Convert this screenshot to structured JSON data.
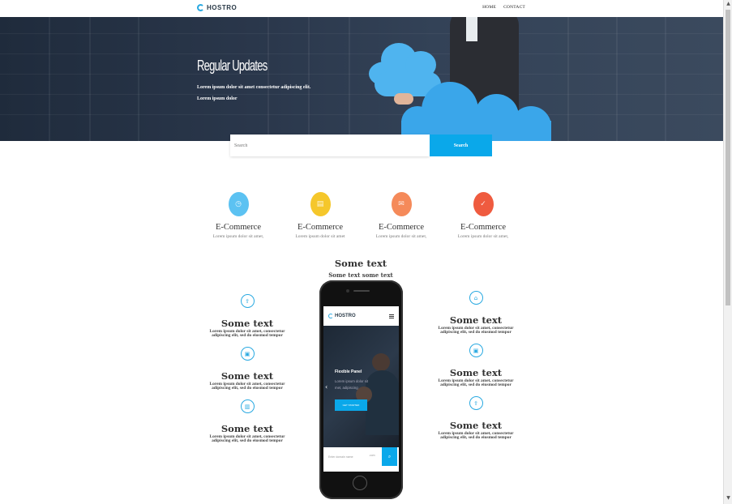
{
  "brand": {
    "name": "HOSTRO"
  },
  "nav": {
    "items": [
      {
        "label": "HOME"
      },
      {
        "label": "CONTACT"
      }
    ]
  },
  "hero": {
    "title": "Regular Updates",
    "line1": "Lorem ipsum dolor sit amet consectetur adipiscing elit.",
    "line2": "Lorem ipsum dolor"
  },
  "search": {
    "placeholder": "Search",
    "button_label": "Search"
  },
  "features": [
    {
      "title": "E-Commerce",
      "desc": "Lorem ipsum dolor sit amet,",
      "color": "#5cc2f2",
      "icon": "clock-icon"
    },
    {
      "title": "E-Commerce",
      "desc": "Lorem ipsum dolor sit amet",
      "color": "#f5c72b",
      "icon": "folder-icon"
    },
    {
      "title": "E-Commerce",
      "desc": "Lorem ipsum dolor sit amet,",
      "color": "#f58a5a",
      "icon": "mail-icon"
    },
    {
      "title": "E-Commerce",
      "desc": "Lorem ipsum dolor sit amet,",
      "color": "#ef5b3f",
      "icon": "check-icon"
    }
  ],
  "center": {
    "title": "Some text",
    "subtitle": "Some text some text"
  },
  "left_items": [
    {
      "title": "Some text",
      "desc": "Lorem ipsum dolor sit amet, consectetur adipiscing elit, sed do eiusmod tempor",
      "icon": "share-icon"
    },
    {
      "title": "Some text",
      "desc": "Lorem ipsum dolor sit amet, consectetur adipiscing elit, sed do eiusmod tempor",
      "icon": "image-icon"
    },
    {
      "title": "Some text",
      "desc": "Lorem ipsum dolor sit amet, consectetur adipiscing elit, sed do eiusmod tempor",
      "icon": "bar-chart-icon"
    }
  ],
  "right_items": [
    {
      "title": "Some text",
      "desc": "Lorem ipsum dolor sit amet, consectetur adipiscing elit, sed do eiusmod tempor",
      "icon": "home-icon"
    },
    {
      "title": "Some text",
      "desc": "Lorem ipsum dolor sit amet, consectetur adipiscing elit, sed do eiusmod tempor",
      "icon": "image-icon"
    },
    {
      "title": "Some text",
      "desc": "Lorem ipsum dolor sit amet, consectetur adipiscing elit, sed do eiusmod tempor",
      "icon": "share-icon"
    }
  ],
  "phone": {
    "brand": "HOSTRO",
    "slide_title": "Flexible Panel",
    "slide_text1": "Lorem ipsum dolor sit",
    "slide_text2": "met, adipiscing",
    "slide_button": "GET STARTED",
    "search_placeholder": "Enter domain name",
    "search_select": ".com"
  },
  "colors": {
    "accent": "#0aa8ea"
  }
}
